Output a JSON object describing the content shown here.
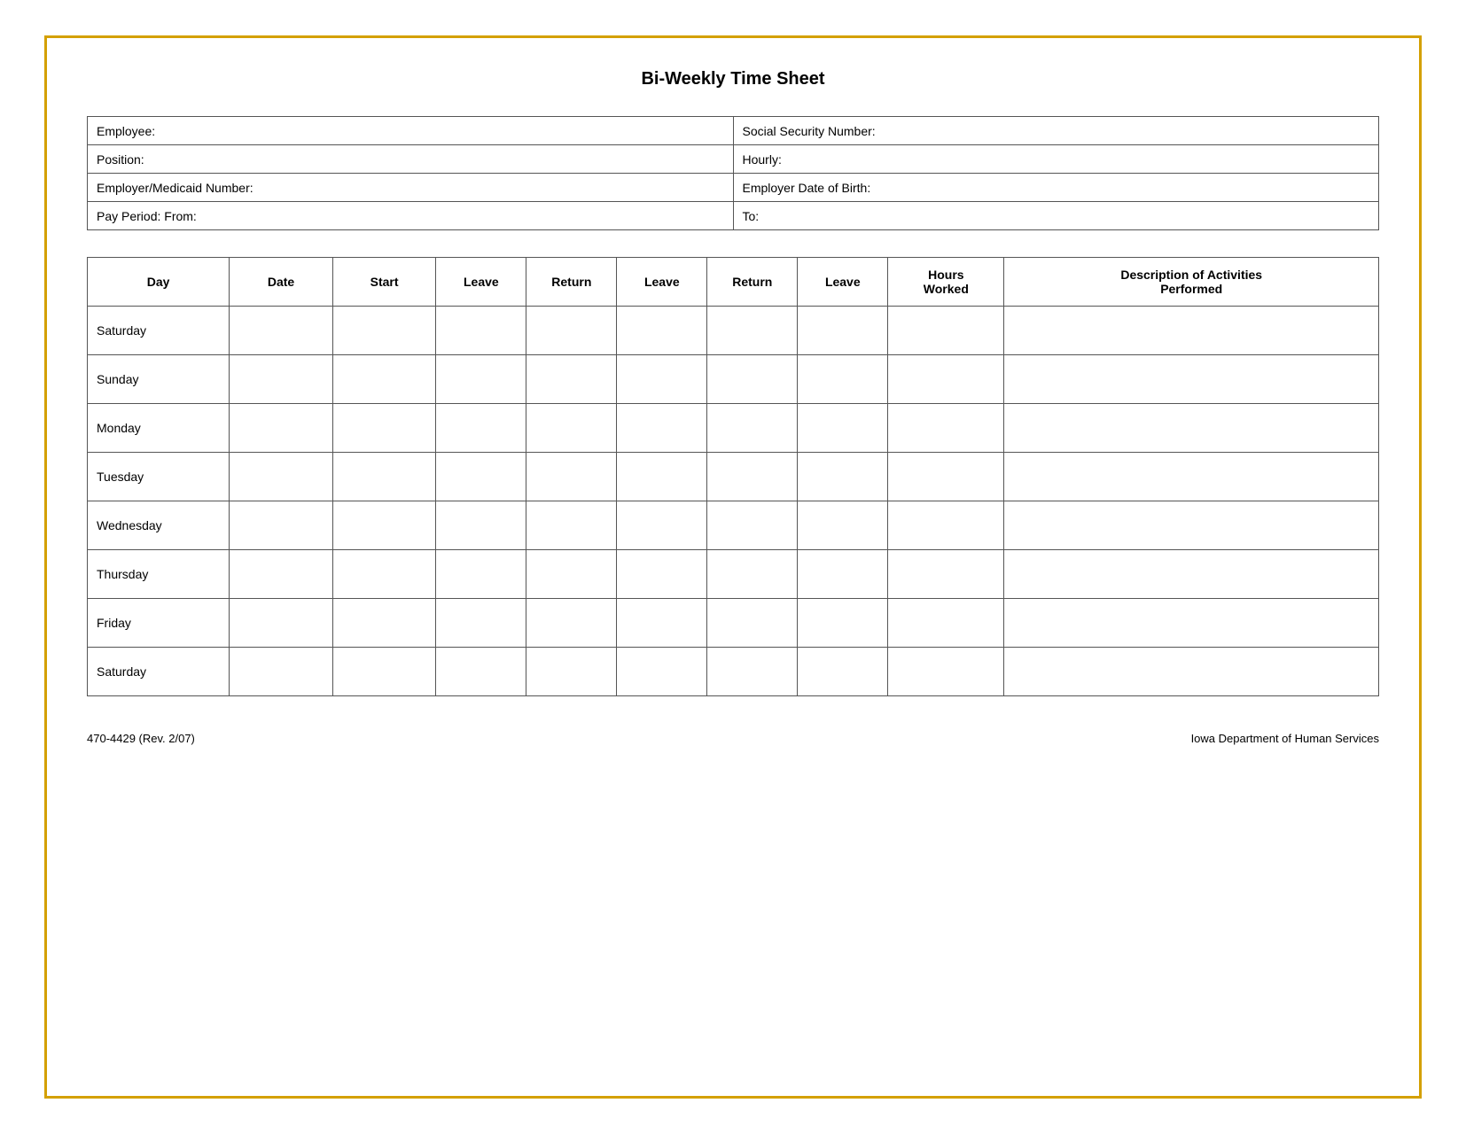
{
  "title": "Bi-Weekly Time Sheet",
  "info_rows": [
    {
      "left_label": "Employee:",
      "right_label": "Social Security Number:"
    },
    {
      "left_label": "Position:",
      "right_label": "Hourly:"
    },
    {
      "left_label": "Employer/Medicaid Number:",
      "right_label": "Employer Date of Birth:"
    },
    {
      "left_label": "Pay Period:  From:",
      "right_label": "To:"
    }
  ],
  "columns": [
    {
      "id": "day",
      "label": "Day"
    },
    {
      "id": "date",
      "label": "Date"
    },
    {
      "id": "start",
      "label": "Start"
    },
    {
      "id": "leave1",
      "label": "Leave"
    },
    {
      "id": "return1",
      "label": "Return"
    },
    {
      "id": "leave2",
      "label": "Leave"
    },
    {
      "id": "return2",
      "label": "Return"
    },
    {
      "id": "leave3",
      "label": "Leave"
    },
    {
      "id": "hours",
      "label": "Hours\nWorked"
    },
    {
      "id": "desc",
      "label": "Description of Activities\nPerformed"
    }
  ],
  "rows": [
    {
      "day": "Saturday"
    },
    {
      "day": "Sunday"
    },
    {
      "day": "Monday"
    },
    {
      "day": "Tuesday"
    },
    {
      "day": "Wednesday"
    },
    {
      "day": "Thursday"
    },
    {
      "day": "Friday"
    },
    {
      "day": "Saturday"
    }
  ],
  "footer": {
    "left": "470-4429  (Rev. 2/07)",
    "right": "Iowa Department of Human Services"
  }
}
